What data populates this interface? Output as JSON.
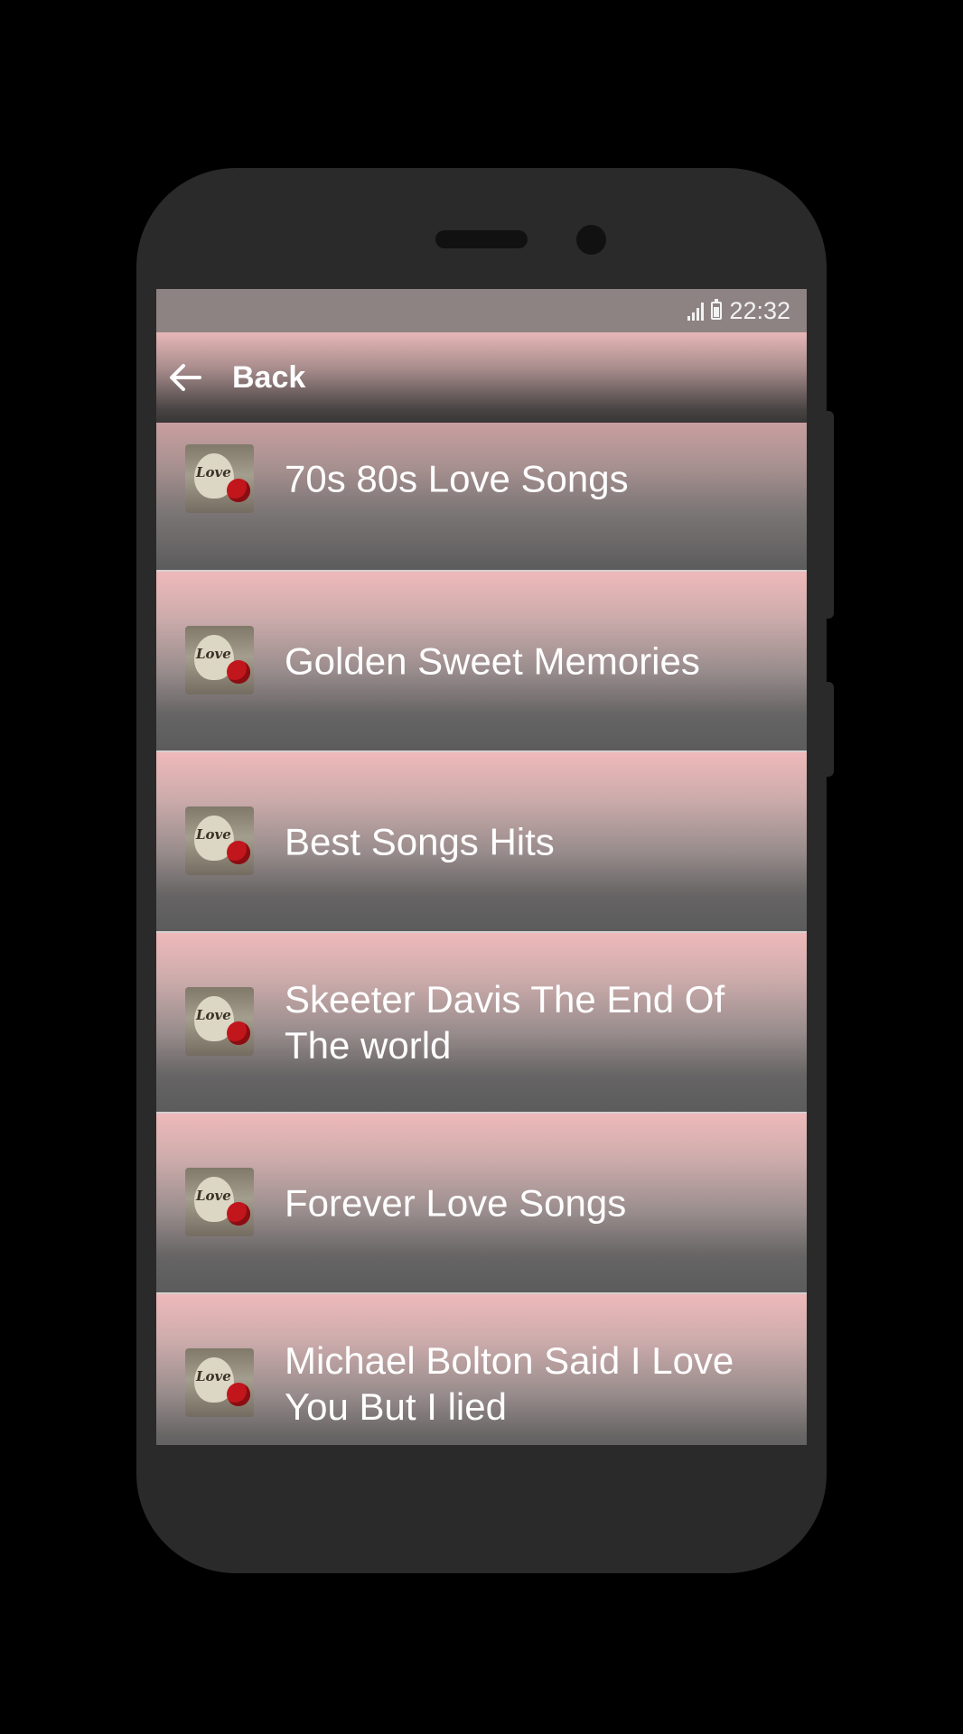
{
  "status_bar": {
    "time": "22:32",
    "signal_icon": "signal-icon",
    "battery_icon": "battery-icon"
  },
  "toolbar": {
    "back_icon": "arrow-left-icon",
    "back_label": "Back"
  },
  "list": {
    "items": [
      {
        "label": "70s 80s Love Songs",
        "thumbnail": "love-heart-rose-thumbnail",
        "thumb_text": "Love"
      },
      {
        "label": "Golden Sweet Memories",
        "thumbnail": "love-heart-rose-thumbnail",
        "thumb_text": "Love"
      },
      {
        "label": "Best Songs Hits",
        "thumbnail": "love-heart-rose-thumbnail",
        "thumb_text": "Love"
      },
      {
        "label": "Skeeter Davis The End Of The world",
        "thumbnail": "love-heart-rose-thumbnail",
        "thumb_text": "Love"
      },
      {
        "label": "Forever Love Songs",
        "thumbnail": "love-heart-rose-thumbnail",
        "thumb_text": "Love"
      },
      {
        "label": "Michael Bolton Said I Love You But I lied",
        "thumbnail": "love-heart-rose-thumbnail",
        "thumb_text": "Love"
      }
    ]
  },
  "colors": {
    "background": "#000000",
    "phone_body": "#2a2a2a",
    "status_bar": "#8e8383",
    "item_top": "#efb9ba",
    "item_bottom": "#5c5c5c",
    "text": "#ffffff"
  }
}
